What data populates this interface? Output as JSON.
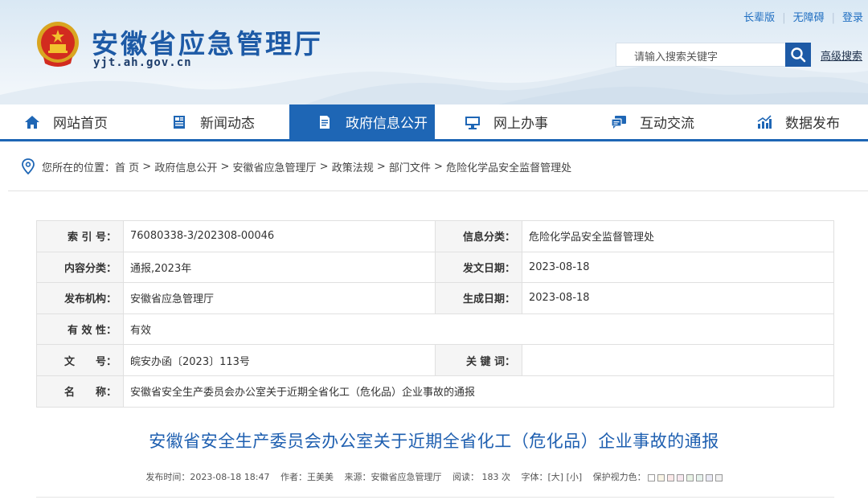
{
  "header": {
    "site_title": "安徽省应急管理厅",
    "site_domain": "yjt.ah.gov.cn",
    "top_links": [
      "长辈版",
      "无障碍",
      "登录"
    ],
    "search_placeholder": "请输入搜索关键字",
    "advanced_search": "高级搜索"
  },
  "nav": {
    "items": [
      {
        "label": "网站首页",
        "icon": "home-icon"
      },
      {
        "label": "新闻动态",
        "icon": "newspaper-icon"
      },
      {
        "label": "政府信息公开",
        "icon": "document-icon",
        "active": true
      },
      {
        "label": "网上办事",
        "icon": "monitor-icon"
      },
      {
        "label": "互动交流",
        "icon": "chat-icon"
      },
      {
        "label": "数据发布",
        "icon": "chart-icon"
      }
    ],
    "accent_color": "#1e66b5"
  },
  "breadcrumb": {
    "prefix": "您所在的位置：",
    "items": [
      "首 页",
      "政府信息公开",
      "安徽省应急管理厅",
      "政策法规",
      "部门文件",
      "危险化学品安全监督管理处"
    ],
    "separator": " > "
  },
  "info": {
    "index_label": "索 引 号：",
    "index_value": "76080338-3/202308-00046",
    "category_label": "信息分类：",
    "category_value": "危险化学品安全监督管理处",
    "content_label": "内容分类：",
    "content_value": "通报,2023年",
    "issue_date_label": "发文日期：",
    "issue_date_value": "2023-08-18",
    "org_label": "发布机构：",
    "org_value": "安徽省应急管理厅",
    "gen_date_label": "生成日期：",
    "gen_date_value": "2023-08-18",
    "validity_label": "有 效 性：",
    "validity_value": "有效",
    "doc_no_label": "文　　号：",
    "doc_no_value": "皖安办函〔2023〕113号",
    "keywords_label": "关 键 词：",
    "keywords_value": "",
    "name_label": "名　　称：",
    "name_value": "安徽省安全生产委员会办公室关于近期全省化工（危化品）企业事故的通报"
  },
  "article": {
    "title": "安徽省安全生产委员会办公室关于近期全省化工（危化品）企业事故的通报",
    "publish_time": "发布时间：2023-08-18 18:47",
    "author": "作者：王美美",
    "source": "来源：安徽省应急管理厅",
    "reads": "阅读： 183  次",
    "font_label": "字体：",
    "font_large": "[大]",
    "font_small": "[小]",
    "eye_label": "保护视力色：",
    "eye_colors": [
      "#ffffff",
      "#faf5e6",
      "#fbe8e8",
      "#f7e8ef",
      "#e8f3e5",
      "#e5f2ec",
      "#eaeaf5",
      "#f1f1f1"
    ]
  }
}
